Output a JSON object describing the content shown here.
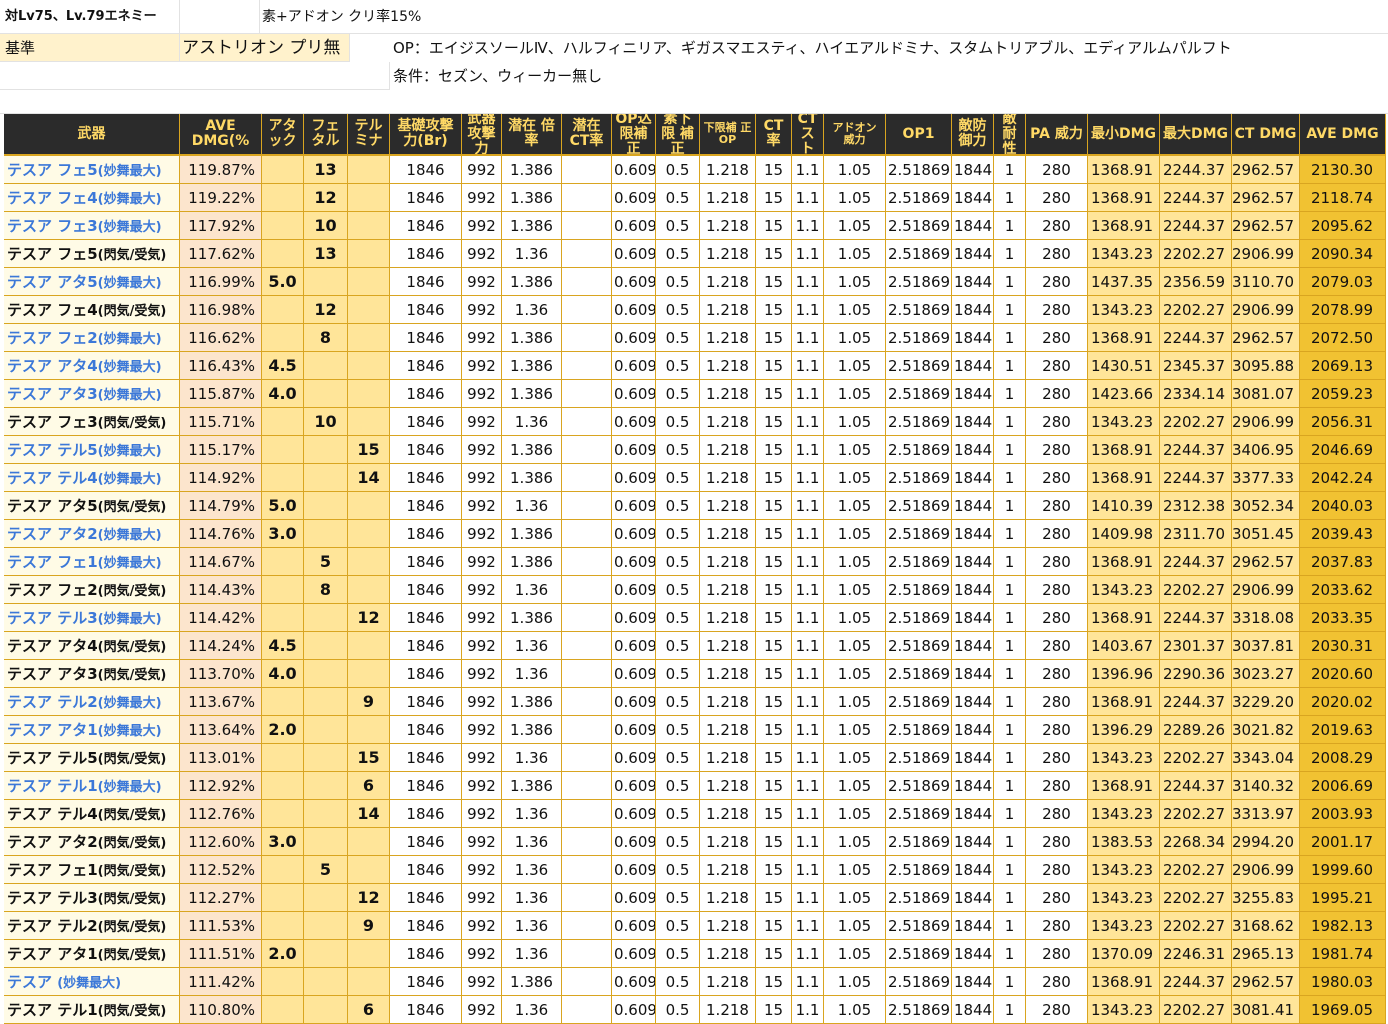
{
  "sheet": {
    "title": "対Lv75、Lv.79エネミー",
    "subtitle": "素+アドオン クリ率15%",
    "base_label": "基準",
    "base_value": "アストリオン プリ無",
    "op_note": "OP：エイジスソールⅣ、ハルフィニリア、ギガスマエスティ、ハイエアルドミナ、スタムトリアブル、エディアルムパルフト",
    "cond_note": "条件：セズン、ウィーカー無し"
  },
  "columns": [
    {
      "label": "武器",
      "icon": "none"
    },
    {
      "label": "AVE DMG(%",
      "icon": "none"
    },
    {
      "label": "アタ ック",
      "icon": "none"
    },
    {
      "label": "フェ タル",
      "icon": "none"
    },
    {
      "label": "テル ミナ",
      "icon": "none"
    },
    {
      "label": "基礎攻撃 力(Br)",
      "icon": "none"
    },
    {
      "label": "武器 攻撃力",
      "icon": "none"
    },
    {
      "label": "潜在 倍率",
      "icon": "none"
    },
    {
      "label": "潜在 CT率",
      "icon": "none"
    },
    {
      "label": "OP込 限補正",
      "icon": "none"
    },
    {
      "label": "素下限 補正",
      "icon": "none"
    },
    {
      "label": "下限補 正OP",
      "icon": "none"
    },
    {
      "label": "CT 率",
      "icon": "none"
    },
    {
      "label": "CT スト",
      "icon": "none"
    },
    {
      "label": "アドオン 威力",
      "icon": "none"
    },
    {
      "label": "OP1",
      "icon": "none"
    },
    {
      "label": "敵防 御力",
      "icon": "none"
    },
    {
      "label": "敵 耐性",
      "icon": "none"
    },
    {
      "label": "PA 威力",
      "icon": "none"
    },
    {
      "label": "最小DMG",
      "icon": "none"
    },
    {
      "label": "最大DMG",
      "icon": "none"
    },
    {
      "label": "CT DMG",
      "icon": "none"
    },
    {
      "label": "AVE DMG",
      "icon": "none"
    }
  ],
  "rows": [
    {
      "name": "テスア フェ5",
      "suffix": "(妙舞最大)",
      "ave_pct": "119.87%",
      "atk": "",
      "fet": "13",
      "ter": "",
      "base_atk": "1846",
      "weapon_atk": "992",
      "latent": "1.386",
      "latent_ct": "",
      "op_lim": "0.609",
      "min_fix": "0.5",
      "min_op": "1.218",
      "ct_rate": "15",
      "ct_str": "1.1",
      "addon": "1.05",
      "op1": "2.518690",
      "def": "1844",
      "res_v": "1",
      "pa": "280",
      "min_dmg": "1368.91",
      "max_dmg": "2244.37",
      "ct_dmg": "2962.57",
      "ave_dmg": "2130.30"
    },
    {
      "name": "テスア フェ4",
      "suffix": "(妙舞最大)",
      "ave_pct": "119.22%",
      "atk": "",
      "fet": "12",
      "ter": "",
      "base_atk": "1846",
      "weapon_atk": "992",
      "latent": "1.386",
      "latent_ct": "",
      "op_lim": "0.609",
      "min_fix": "0.5",
      "min_op": "1.218",
      "ct_rate": "15",
      "ct_str": "1.1",
      "addon": "1.05",
      "op1": "2.518690",
      "def": "1844",
      "res_v": "1",
      "pa": "280",
      "min_dmg": "1368.91",
      "max_dmg": "2244.37",
      "ct_dmg": "2962.57",
      "ave_dmg": "2118.74"
    },
    {
      "name": "テスア フェ3",
      "suffix": "(妙舞最大)",
      "ave_pct": "117.92%",
      "atk": "",
      "fet": "10",
      "ter": "",
      "base_atk": "1846",
      "weapon_atk": "992",
      "latent": "1.386",
      "latent_ct": "",
      "op_lim": "0.609",
      "min_fix": "0.5",
      "min_op": "1.218",
      "ct_rate": "15",
      "ct_str": "1.1",
      "addon": "1.05",
      "op1": "2.518690",
      "def": "1844",
      "res_v": "1",
      "pa": "280",
      "min_dmg": "1368.91",
      "max_dmg": "2244.37",
      "ct_dmg": "2962.57",
      "ave_dmg": "2095.62"
    },
    {
      "name": "テスア フェ5",
      "suffix": "(閃気/受気)",
      "ave_pct": "117.62%",
      "atk": "",
      "fet": "13",
      "ter": "",
      "base_atk": "1846",
      "weapon_atk": "992",
      "latent": "1.36",
      "latent_ct": "",
      "op_lim": "0.609",
      "min_fix": "0.5",
      "min_op": "1.218",
      "ct_rate": "15",
      "ct_str": "1.1",
      "addon": "1.05",
      "op1": "2.518690",
      "def": "1844",
      "res_v": "1",
      "pa": "280",
      "min_dmg": "1343.23",
      "max_dmg": "2202.27",
      "ct_dmg": "2906.99",
      "ave_dmg": "2090.34"
    },
    {
      "name": "テスア アタ5",
      "suffix": "(妙舞最大)",
      "ave_pct": "116.99%",
      "atk": "5.0",
      "fet": "",
      "ter": "",
      "base_atk": "1846",
      "weapon_atk": "992",
      "latent": "1.386",
      "latent_ct": "",
      "op_lim": "0.609",
      "min_fix": "0.5",
      "min_op": "1.218",
      "ct_rate": "15",
      "ct_str": "1.1",
      "addon": "1.05",
      "op1": "2.518690",
      "def": "1844",
      "res_v": "1",
      "pa": "280",
      "min_dmg": "1437.35",
      "max_dmg": "2356.59",
      "ct_dmg": "3110.70",
      "ave_dmg": "2079.03"
    },
    {
      "name": "テスア フェ4",
      "suffix": "(閃気/受気)",
      "ave_pct": "116.98%",
      "atk": "",
      "fet": "12",
      "ter": "",
      "base_atk": "1846",
      "weapon_atk": "992",
      "latent": "1.36",
      "latent_ct": "",
      "op_lim": "0.609",
      "min_fix": "0.5",
      "min_op": "1.218",
      "ct_rate": "15",
      "ct_str": "1.1",
      "addon": "1.05",
      "op1": "2.518690",
      "def": "1844",
      "res_v": "1",
      "pa": "280",
      "min_dmg": "1343.23",
      "max_dmg": "2202.27",
      "ct_dmg": "2906.99",
      "ave_dmg": "2078.99"
    },
    {
      "name": "テスア フェ2",
      "suffix": "(妙舞最大)",
      "ave_pct": "116.62%",
      "atk": "",
      "fet": "8",
      "ter": "",
      "base_atk": "1846",
      "weapon_atk": "992",
      "latent": "1.386",
      "latent_ct": "",
      "op_lim": "0.609",
      "min_fix": "0.5",
      "min_op": "1.218",
      "ct_rate": "15",
      "ct_str": "1.1",
      "addon": "1.05",
      "op1": "2.518690",
      "def": "1844",
      "res_v": "1",
      "pa": "280",
      "min_dmg": "1368.91",
      "max_dmg": "2244.37",
      "ct_dmg": "2962.57",
      "ave_dmg": "2072.50"
    },
    {
      "name": "テスア アタ4",
      "suffix": "(妙舞最大)",
      "ave_pct": "116.43%",
      "atk": "4.5",
      "fet": "",
      "ter": "",
      "base_atk": "1846",
      "weapon_atk": "992",
      "latent": "1.386",
      "latent_ct": "",
      "op_lim": "0.609",
      "min_fix": "0.5",
      "min_op": "1.218",
      "ct_rate": "15",
      "ct_str": "1.1",
      "addon": "1.05",
      "op1": "2.518690",
      "def": "1844",
      "res_v": "1",
      "pa": "280",
      "min_dmg": "1430.51",
      "max_dmg": "2345.37",
      "ct_dmg": "3095.88",
      "ave_dmg": "2069.13"
    },
    {
      "name": "テスア アタ3",
      "suffix": "(妙舞最大)",
      "ave_pct": "115.87%",
      "atk": "4.0",
      "fet": "",
      "ter": "",
      "base_atk": "1846",
      "weapon_atk": "992",
      "latent": "1.386",
      "latent_ct": "",
      "op_lim": "0.609",
      "min_fix": "0.5",
      "min_op": "1.218",
      "ct_rate": "15",
      "ct_str": "1.1",
      "addon": "1.05",
      "op1": "2.518690",
      "def": "1844",
      "res_v": "1",
      "pa": "280",
      "min_dmg": "1423.66",
      "max_dmg": "2334.14",
      "ct_dmg": "3081.07",
      "ave_dmg": "2059.23"
    },
    {
      "name": "テスア フェ3",
      "suffix": "(閃気/受気)",
      "ave_pct": "115.71%",
      "atk": "",
      "fet": "10",
      "ter": "",
      "base_atk": "1846",
      "weapon_atk": "992",
      "latent": "1.36",
      "latent_ct": "",
      "op_lim": "0.609",
      "min_fix": "0.5",
      "min_op": "1.218",
      "ct_rate": "15",
      "ct_str": "1.1",
      "addon": "1.05",
      "op1": "2.518690",
      "def": "1844",
      "res_v": "1",
      "pa": "280",
      "min_dmg": "1343.23",
      "max_dmg": "2202.27",
      "ct_dmg": "2906.99",
      "ave_dmg": "2056.31"
    },
    {
      "name": "テスア テル5",
      "suffix": "(妙舞最大)",
      "ave_pct": "115.17%",
      "atk": "",
      "fet": "",
      "ter": "15",
      "base_atk": "1846",
      "weapon_atk": "992",
      "latent": "1.386",
      "latent_ct": "",
      "op_lim": "0.609",
      "min_fix": "0.5",
      "min_op": "1.218",
      "ct_rate": "15",
      "ct_str": "1.1",
      "addon": "1.05",
      "op1": "2.518690",
      "def": "1844",
      "res_v": "1",
      "pa": "280",
      "min_dmg": "1368.91",
      "max_dmg": "2244.37",
      "ct_dmg": "3406.95",
      "ave_dmg": "2046.69"
    },
    {
      "name": "テスア テル4",
      "suffix": "(妙舞最大)",
      "ave_pct": "114.92%",
      "atk": "",
      "fet": "",
      "ter": "14",
      "base_atk": "1846",
      "weapon_atk": "992",
      "latent": "1.386",
      "latent_ct": "",
      "op_lim": "0.609",
      "min_fix": "0.5",
      "min_op": "1.218",
      "ct_rate": "15",
      "ct_str": "1.1",
      "addon": "1.05",
      "op1": "2.518690",
      "def": "1844",
      "res_v": "1",
      "pa": "280",
      "min_dmg": "1368.91",
      "max_dmg": "2244.37",
      "ct_dmg": "3377.33",
      "ave_dmg": "2042.24"
    },
    {
      "name": "テスア アタ5",
      "suffix": "(閃気/受気)",
      "ave_pct": "114.79%",
      "atk": "5.0",
      "fet": "",
      "ter": "",
      "base_atk": "1846",
      "weapon_atk": "992",
      "latent": "1.36",
      "latent_ct": "",
      "op_lim": "0.609",
      "min_fix": "0.5",
      "min_op": "1.218",
      "ct_rate": "15",
      "ct_str": "1.1",
      "addon": "1.05",
      "op1": "2.518690",
      "def": "1844",
      "res_v": "1",
      "pa": "280",
      "min_dmg": "1410.39",
      "max_dmg": "2312.38",
      "ct_dmg": "3052.34",
      "ave_dmg": "2040.03"
    },
    {
      "name": "テスア アタ2",
      "suffix": "(妙舞最大)",
      "ave_pct": "114.76%",
      "atk": "3.0",
      "fet": "",
      "ter": "",
      "base_atk": "1846",
      "weapon_atk": "992",
      "latent": "1.386",
      "latent_ct": "",
      "op_lim": "0.609",
      "min_fix": "0.5",
      "min_op": "1.218",
      "ct_rate": "15",
      "ct_str": "1.1",
      "addon": "1.05",
      "op1": "2.518690",
      "def": "1844",
      "res_v": "1",
      "pa": "280",
      "min_dmg": "1409.98",
      "max_dmg": "2311.70",
      "ct_dmg": "3051.45",
      "ave_dmg": "2039.43"
    },
    {
      "name": "テスア フェ1",
      "suffix": "(妙舞最大)",
      "ave_pct": "114.67%",
      "atk": "",
      "fet": "5",
      "ter": "",
      "base_atk": "1846",
      "weapon_atk": "992",
      "latent": "1.386",
      "latent_ct": "",
      "op_lim": "0.609",
      "min_fix": "0.5",
      "min_op": "1.218",
      "ct_rate": "15",
      "ct_str": "1.1",
      "addon": "1.05",
      "op1": "2.518690",
      "def": "1844",
      "res_v": "1",
      "pa": "280",
      "min_dmg": "1368.91",
      "max_dmg": "2244.37",
      "ct_dmg": "2962.57",
      "ave_dmg": "2037.83"
    },
    {
      "name": "テスア フェ2",
      "suffix": "(閃気/受気)",
      "ave_pct": "114.43%",
      "atk": "",
      "fet": "8",
      "ter": "",
      "base_atk": "1846",
      "weapon_atk": "992",
      "latent": "1.36",
      "latent_ct": "",
      "op_lim": "0.609",
      "min_fix": "0.5",
      "min_op": "1.218",
      "ct_rate": "15",
      "ct_str": "1.1",
      "addon": "1.05",
      "op1": "2.518690",
      "def": "1844",
      "res_v": "1",
      "pa": "280",
      "min_dmg": "1343.23",
      "max_dmg": "2202.27",
      "ct_dmg": "2906.99",
      "ave_dmg": "2033.62"
    },
    {
      "name": "テスア テル3",
      "suffix": "(妙舞最大)",
      "ave_pct": "114.42%",
      "atk": "",
      "fet": "",
      "ter": "12",
      "base_atk": "1846",
      "weapon_atk": "992",
      "latent": "1.386",
      "latent_ct": "",
      "op_lim": "0.609",
      "min_fix": "0.5",
      "min_op": "1.218",
      "ct_rate": "15",
      "ct_str": "1.1",
      "addon": "1.05",
      "op1": "2.518690",
      "def": "1844",
      "res_v": "1",
      "pa": "280",
      "min_dmg": "1368.91",
      "max_dmg": "2244.37",
      "ct_dmg": "3318.08",
      "ave_dmg": "2033.35"
    },
    {
      "name": "テスア アタ4",
      "suffix": "(閃気/受気)",
      "ave_pct": "114.24%",
      "atk": "4.5",
      "fet": "",
      "ter": "",
      "base_atk": "1846",
      "weapon_atk": "992",
      "latent": "1.36",
      "latent_ct": "",
      "op_lim": "0.609",
      "min_fix": "0.5",
      "min_op": "1.218",
      "ct_rate": "15",
      "ct_str": "1.1",
      "addon": "1.05",
      "op1": "2.518690",
      "def": "1844",
      "res_v": "1",
      "pa": "280",
      "min_dmg": "1403.67",
      "max_dmg": "2301.37",
      "ct_dmg": "3037.81",
      "ave_dmg": "2030.31"
    },
    {
      "name": "テスア アタ3",
      "suffix": "(閃気/受気)",
      "ave_pct": "113.70%",
      "atk": "4.0",
      "fet": "",
      "ter": "",
      "base_atk": "1846",
      "weapon_atk": "992",
      "latent": "1.36",
      "latent_ct": "",
      "op_lim": "0.609",
      "min_fix": "0.5",
      "min_op": "1.218",
      "ct_rate": "15",
      "ct_str": "1.1",
      "addon": "1.05",
      "op1": "2.518690",
      "def": "1844",
      "res_v": "1",
      "pa": "280",
      "min_dmg": "1396.96",
      "max_dmg": "2290.36",
      "ct_dmg": "3023.27",
      "ave_dmg": "2020.60"
    },
    {
      "name": "テスア テル2",
      "suffix": "(妙舞最大)",
      "ave_pct": "113.67%",
      "atk": "",
      "fet": "",
      "ter": "9",
      "base_atk": "1846",
      "weapon_atk": "992",
      "latent": "1.386",
      "latent_ct": "",
      "op_lim": "0.609",
      "min_fix": "0.5",
      "min_op": "1.218",
      "ct_rate": "15",
      "ct_str": "1.1",
      "addon": "1.05",
      "op1": "2.518690",
      "def": "1844",
      "res_v": "1",
      "pa": "280",
      "min_dmg": "1368.91",
      "max_dmg": "2244.37",
      "ct_dmg": "3229.20",
      "ave_dmg": "2020.02"
    },
    {
      "name": "テスア アタ1",
      "suffix": "(妙舞最大)",
      "ave_pct": "113.64%",
      "atk": "2.0",
      "fet": "",
      "ter": "",
      "base_atk": "1846",
      "weapon_atk": "992",
      "latent": "1.386",
      "latent_ct": "",
      "op_lim": "0.609",
      "min_fix": "0.5",
      "min_op": "1.218",
      "ct_rate": "15",
      "ct_str": "1.1",
      "addon": "1.05",
      "op1": "2.518690",
      "def": "1844",
      "res_v": "1",
      "pa": "280",
      "min_dmg": "1396.29",
      "max_dmg": "2289.26",
      "ct_dmg": "3021.82",
      "ave_dmg": "2019.63"
    },
    {
      "name": "テスア テル5",
      "suffix": "(閃気/受気)",
      "ave_pct": "113.01%",
      "atk": "",
      "fet": "",
      "ter": "15",
      "base_atk": "1846",
      "weapon_atk": "992",
      "latent": "1.36",
      "latent_ct": "",
      "op_lim": "0.609",
      "min_fix": "0.5",
      "min_op": "1.218",
      "ct_rate": "15",
      "ct_str": "1.1",
      "addon": "1.05",
      "op1": "2.518690",
      "def": "1844",
      "res_v": "1",
      "pa": "280",
      "min_dmg": "1343.23",
      "max_dmg": "2202.27",
      "ct_dmg": "3343.04",
      "ave_dmg": "2008.29"
    },
    {
      "name": "テスア テル1",
      "suffix": "(妙舞最大)",
      "ave_pct": "112.92%",
      "atk": "",
      "fet": "",
      "ter": "6",
      "base_atk": "1846",
      "weapon_atk": "992",
      "latent": "1.386",
      "latent_ct": "",
      "op_lim": "0.609",
      "min_fix": "0.5",
      "min_op": "1.218",
      "ct_rate": "15",
      "ct_str": "1.1",
      "addon": "1.05",
      "op1": "2.518690",
      "def": "1844",
      "res_v": "1",
      "pa": "280",
      "min_dmg": "1368.91",
      "max_dmg": "2244.37",
      "ct_dmg": "3140.32",
      "ave_dmg": "2006.69"
    },
    {
      "name": "テスア テル4",
      "suffix": "(閃気/受気)",
      "ave_pct": "112.76%",
      "atk": "",
      "fet": "",
      "ter": "14",
      "base_atk": "1846",
      "weapon_atk": "992",
      "latent": "1.36",
      "latent_ct": "",
      "op_lim": "0.609",
      "min_fix": "0.5",
      "min_op": "1.218",
      "ct_rate": "15",
      "ct_str": "1.1",
      "addon": "1.05",
      "op1": "2.518690",
      "def": "1844",
      "res_v": "1",
      "pa": "280",
      "min_dmg": "1343.23",
      "max_dmg": "2202.27",
      "ct_dmg": "3313.97",
      "ave_dmg": "2003.93"
    },
    {
      "name": "テスア アタ2",
      "suffix": "(閃気/受気)",
      "ave_pct": "112.60%",
      "atk": "3.0",
      "fet": "",
      "ter": "",
      "base_atk": "1846",
      "weapon_atk": "992",
      "latent": "1.36",
      "latent_ct": "",
      "op_lim": "0.609",
      "min_fix": "0.5",
      "min_op": "1.218",
      "ct_rate": "15",
      "ct_str": "1.1",
      "addon": "1.05",
      "op1": "2.518690",
      "def": "1844",
      "res_v": "1",
      "pa": "280",
      "min_dmg": "1383.53",
      "max_dmg": "2268.34",
      "ct_dmg": "2994.20",
      "ave_dmg": "2001.17"
    },
    {
      "name": "テスア フェ1",
      "suffix": "(閃気/受気)",
      "ave_pct": "112.52%",
      "atk": "",
      "fet": "5",
      "ter": "",
      "base_atk": "1846",
      "weapon_atk": "992",
      "latent": "1.36",
      "latent_ct": "",
      "op_lim": "0.609",
      "min_fix": "0.5",
      "min_op": "1.218",
      "ct_rate": "15",
      "ct_str": "1.1",
      "addon": "1.05",
      "op1": "2.518690",
      "def": "1844",
      "res_v": "1",
      "pa": "280",
      "min_dmg": "1343.23",
      "max_dmg": "2202.27",
      "ct_dmg": "2906.99",
      "ave_dmg": "1999.60"
    },
    {
      "name": "テスア テル3",
      "suffix": "(閃気/受気)",
      "ave_pct": "112.27%",
      "atk": "",
      "fet": "",
      "ter": "12",
      "base_atk": "1846",
      "weapon_atk": "992",
      "latent": "1.36",
      "latent_ct": "",
      "op_lim": "0.609",
      "min_fix": "0.5",
      "min_op": "1.218",
      "ct_rate": "15",
      "ct_str": "1.1",
      "addon": "1.05",
      "op1": "2.518690",
      "def": "1844",
      "res_v": "1",
      "pa": "280",
      "min_dmg": "1343.23",
      "max_dmg": "2202.27",
      "ct_dmg": "3255.83",
      "ave_dmg": "1995.21"
    },
    {
      "name": "テスア テル2",
      "suffix": "(閃気/受気)",
      "ave_pct": "111.53%",
      "atk": "",
      "fet": "",
      "ter": "9",
      "base_atk": "1846",
      "weapon_atk": "992",
      "latent": "1.36",
      "latent_ct": "",
      "op_lim": "0.609",
      "min_fix": "0.5",
      "min_op": "1.218",
      "ct_rate": "15",
      "ct_str": "1.1",
      "addon": "1.05",
      "op1": "2.518690",
      "def": "1844",
      "res_v": "1",
      "pa": "280",
      "min_dmg": "1343.23",
      "max_dmg": "2202.27",
      "ct_dmg": "3168.62",
      "ave_dmg": "1982.13"
    },
    {
      "name": "テスア アタ1",
      "suffix": "(閃気/受気)",
      "ave_pct": "111.51%",
      "atk": "2.0",
      "fet": "",
      "ter": "",
      "base_atk": "1846",
      "weapon_atk": "992",
      "latent": "1.36",
      "latent_ct": "",
      "op_lim": "0.609",
      "min_fix": "0.5",
      "min_op": "1.218",
      "ct_rate": "15",
      "ct_str": "1.1",
      "addon": "1.05",
      "op1": "2.518690",
      "def": "1844",
      "res_v": "1",
      "pa": "280",
      "min_dmg": "1370.09",
      "max_dmg": "2246.31",
      "ct_dmg": "2965.13",
      "ave_dmg": "1981.74"
    },
    {
      "name": "テスア ",
      "suffix": "(妙舞最大)",
      "ave_pct": "111.42%",
      "atk": "",
      "fet": "",
      "ter": "",
      "base_atk": "1846",
      "weapon_atk": "992",
      "latent": "1.386",
      "latent_ct": "",
      "op_lim": "0.609",
      "min_fix": "0.5",
      "min_op": "1.218",
      "ct_rate": "15",
      "ct_str": "1.1",
      "addon": "1.05",
      "op1": "2.518690",
      "def": "1844",
      "res_v": "1",
      "pa": "280",
      "min_dmg": "1368.91",
      "max_dmg": "2244.37",
      "ct_dmg": "2962.57",
      "ave_dmg": "1980.03"
    },
    {
      "name": "テスア テル1",
      "suffix": "(閃気/受気)",
      "ave_pct": "110.80%",
      "atk": "",
      "fet": "",
      "ter": "6",
      "base_atk": "1846",
      "weapon_atk": "992",
      "latent": "1.36",
      "latent_ct": "",
      "op_lim": "0.609",
      "min_fix": "0.5",
      "min_op": "1.218",
      "ct_rate": "15",
      "ct_str": "1.1",
      "addon": "1.05",
      "op1": "2.518690",
      "def": "1844",
      "res_v": "1",
      "pa": "280",
      "min_dmg": "1343.23",
      "max_dmg": "2202.27",
      "ct_dmg": "3081.41",
      "ave_dmg": "1969.05"
    }
  ],
  "colors": {
    "header_bg": "#2b2b2b",
    "header_text": "#ffd966",
    "weapon_blue": "#3c78d8",
    "pct_bg": "#fce5cd",
    "op_bg": "#ffe599",
    "ave_bg": "#f1c232",
    "grid_line": "#d9a520"
  }
}
